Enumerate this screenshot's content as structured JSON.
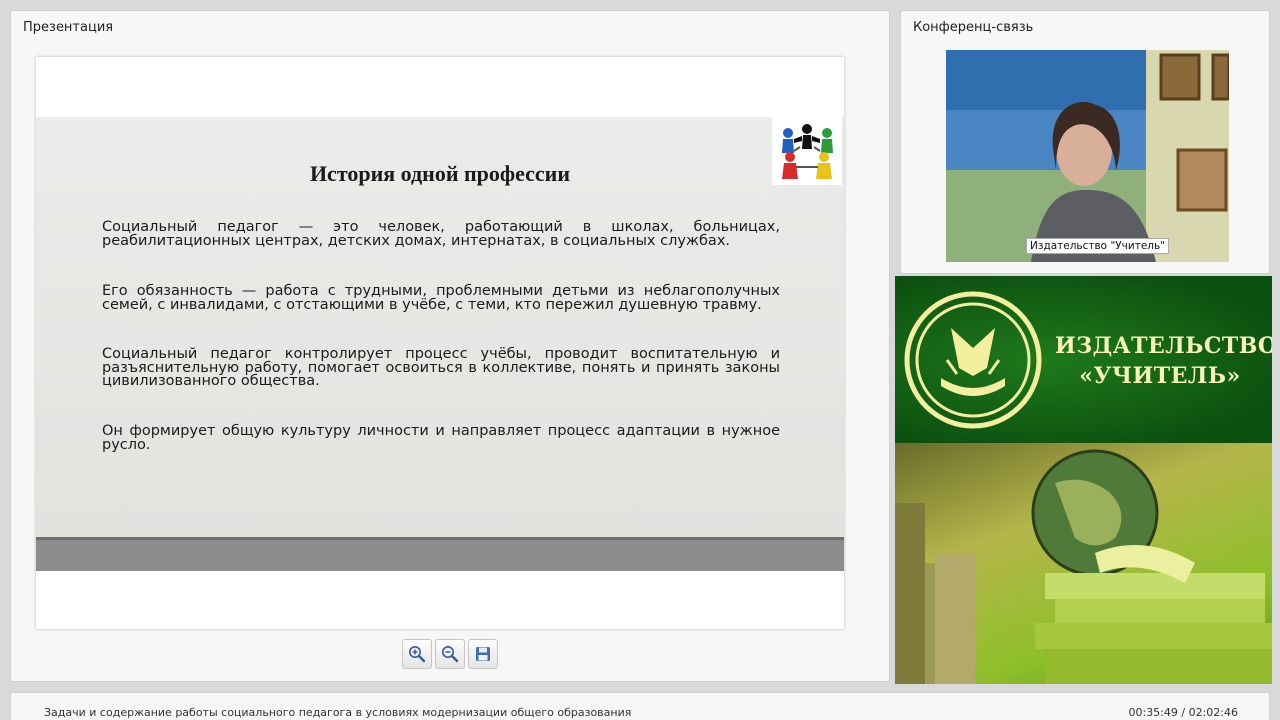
{
  "presentation": {
    "panel_title": "Презентация",
    "slide": {
      "title": "История одной профессии",
      "paragraphs": [
        "Социальный педагог — это человек, работающий в школах, больницах, реабилитационных центрах, детских домах, интернатах, в социальных службах.",
        "Его обязанность — работа с трудными, проблемными детьми из неблагополучных семей, с инвалидами, с отстающими в учёбе, с теми, кто пережил душевную травму.",
        "Социальный педагог контролирует процесс учёбы, проводит воспитательную и разъяснительную работу, помогает освоиться в коллективе, понять и принять законы цивилизованного общества.",
        "Он формирует общую культуру личности и направляет процесс адаптации в нужное русло."
      ]
    },
    "toolbar": {
      "zoom_in_icon": "zoom-in-icon",
      "zoom_out_icon": "zoom-out-icon",
      "save_icon": "save-icon"
    }
  },
  "conference": {
    "panel_title": "Конференц-связь",
    "speaker_label": "Издательство \"Учитель\""
  },
  "banner": {
    "publisher_line1": "ИЗДАТЕЛЬСТВО",
    "publisher_line2": "«УЧИТЕЛЬ»"
  },
  "status_bar": {
    "course_title": "Задачи и содержание работы социального педагога в условиях модернизации общего образования",
    "time": "00:35:49 / 02:02:46"
  },
  "colors": {
    "banner_green": "#0f5c12",
    "slide_bar": "#8c8c8c",
    "publisher_text": "#f7f3b6"
  }
}
